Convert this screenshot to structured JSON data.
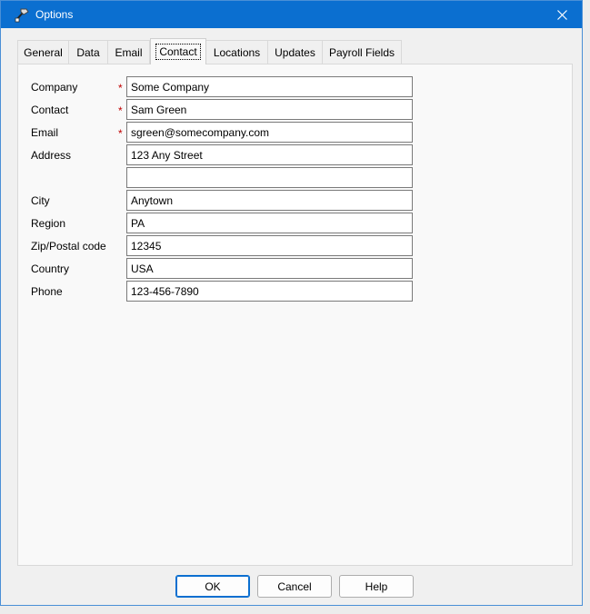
{
  "window": {
    "title": "Options",
    "close_glyph": "✕"
  },
  "tabs": [
    {
      "label": "General"
    },
    {
      "label": "Data"
    },
    {
      "label": "Email"
    },
    {
      "label": "Contact",
      "active": true
    },
    {
      "label": "Locations"
    },
    {
      "label": "Updates"
    },
    {
      "label": "Payroll Fields"
    }
  ],
  "fields": {
    "company": {
      "label": "Company",
      "required": "*",
      "value": "Some Company"
    },
    "contact": {
      "label": "Contact",
      "required": "*",
      "value": "Sam Green"
    },
    "email": {
      "label": "Email",
      "required": "*",
      "value": "sgreen@somecompany.com"
    },
    "address": {
      "label": "Address",
      "value": "123 Any Street"
    },
    "address2": {
      "value": ""
    },
    "city": {
      "label": "City",
      "value": "Anytown"
    },
    "region": {
      "label": "Region",
      "value": "PA"
    },
    "zip": {
      "label": "Zip/Postal code",
      "value": "12345"
    },
    "country": {
      "label": "Country",
      "value": "USA"
    },
    "phone": {
      "label": "Phone",
      "value": "123-456-7890"
    }
  },
  "buttons": {
    "ok": "OK",
    "cancel": "Cancel",
    "help": "Help"
  },
  "colors": {
    "titlebar": "#0b6fd0",
    "required": "#c00000",
    "accent": "#0b6fd0"
  },
  "icons": {
    "app": "app-icon",
    "close": "close-icon"
  }
}
